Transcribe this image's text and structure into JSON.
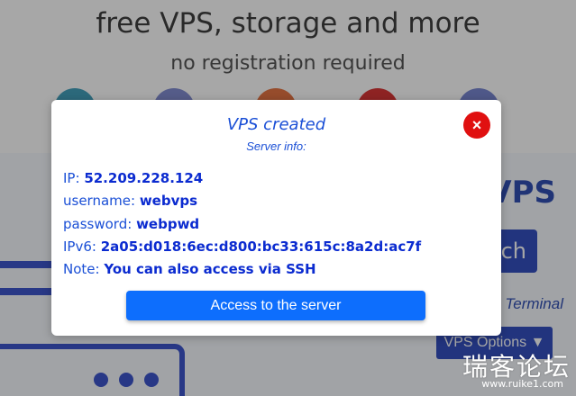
{
  "hero": {
    "title": "free VPS, storage and more",
    "subtitle": "no registration required"
  },
  "logos": [
    {
      "name": "debian-logo-icon",
      "color": "#1f8fb0"
    },
    {
      "name": "cloud-logo-icon",
      "color": "#6a77c9"
    },
    {
      "name": "ubuntu-logo-icon",
      "color": "#e05a1f"
    },
    {
      "name": "redhat-logo-icon",
      "color": "#d10f0f"
    },
    {
      "name": "other-logo-icon",
      "color": "#6070c8"
    }
  ],
  "background": {
    "heading": "VPS",
    "launch_label": "ch",
    "terminal_link": "Terminal",
    "options_label": "VPS Options ▼"
  },
  "modal": {
    "title": "VPS created",
    "subtitle": "Server info:",
    "close_label": "×",
    "ip_label": "IP:",
    "ip_value": "52.209.228.124",
    "username_label": "username:",
    "username_value": "webvps",
    "password_label": "password:",
    "password_value": "webpwd",
    "ipv6_label": "IPv6:",
    "ipv6_value": "2a05:d018:6ec:d800:bc33:615c:8a2d:ac7f",
    "note_label": "Note:",
    "note_value": "You can also access via SSH",
    "access_button": "Access to the server"
  },
  "watermark": {
    "text": "瑞客论坛",
    "url": "www.ruike1.com"
  },
  "colors": {
    "accent": "#0d6efd",
    "navy": "#0d2fb5",
    "close": "#e01010",
    "text_blue": "#1a4fd6"
  }
}
